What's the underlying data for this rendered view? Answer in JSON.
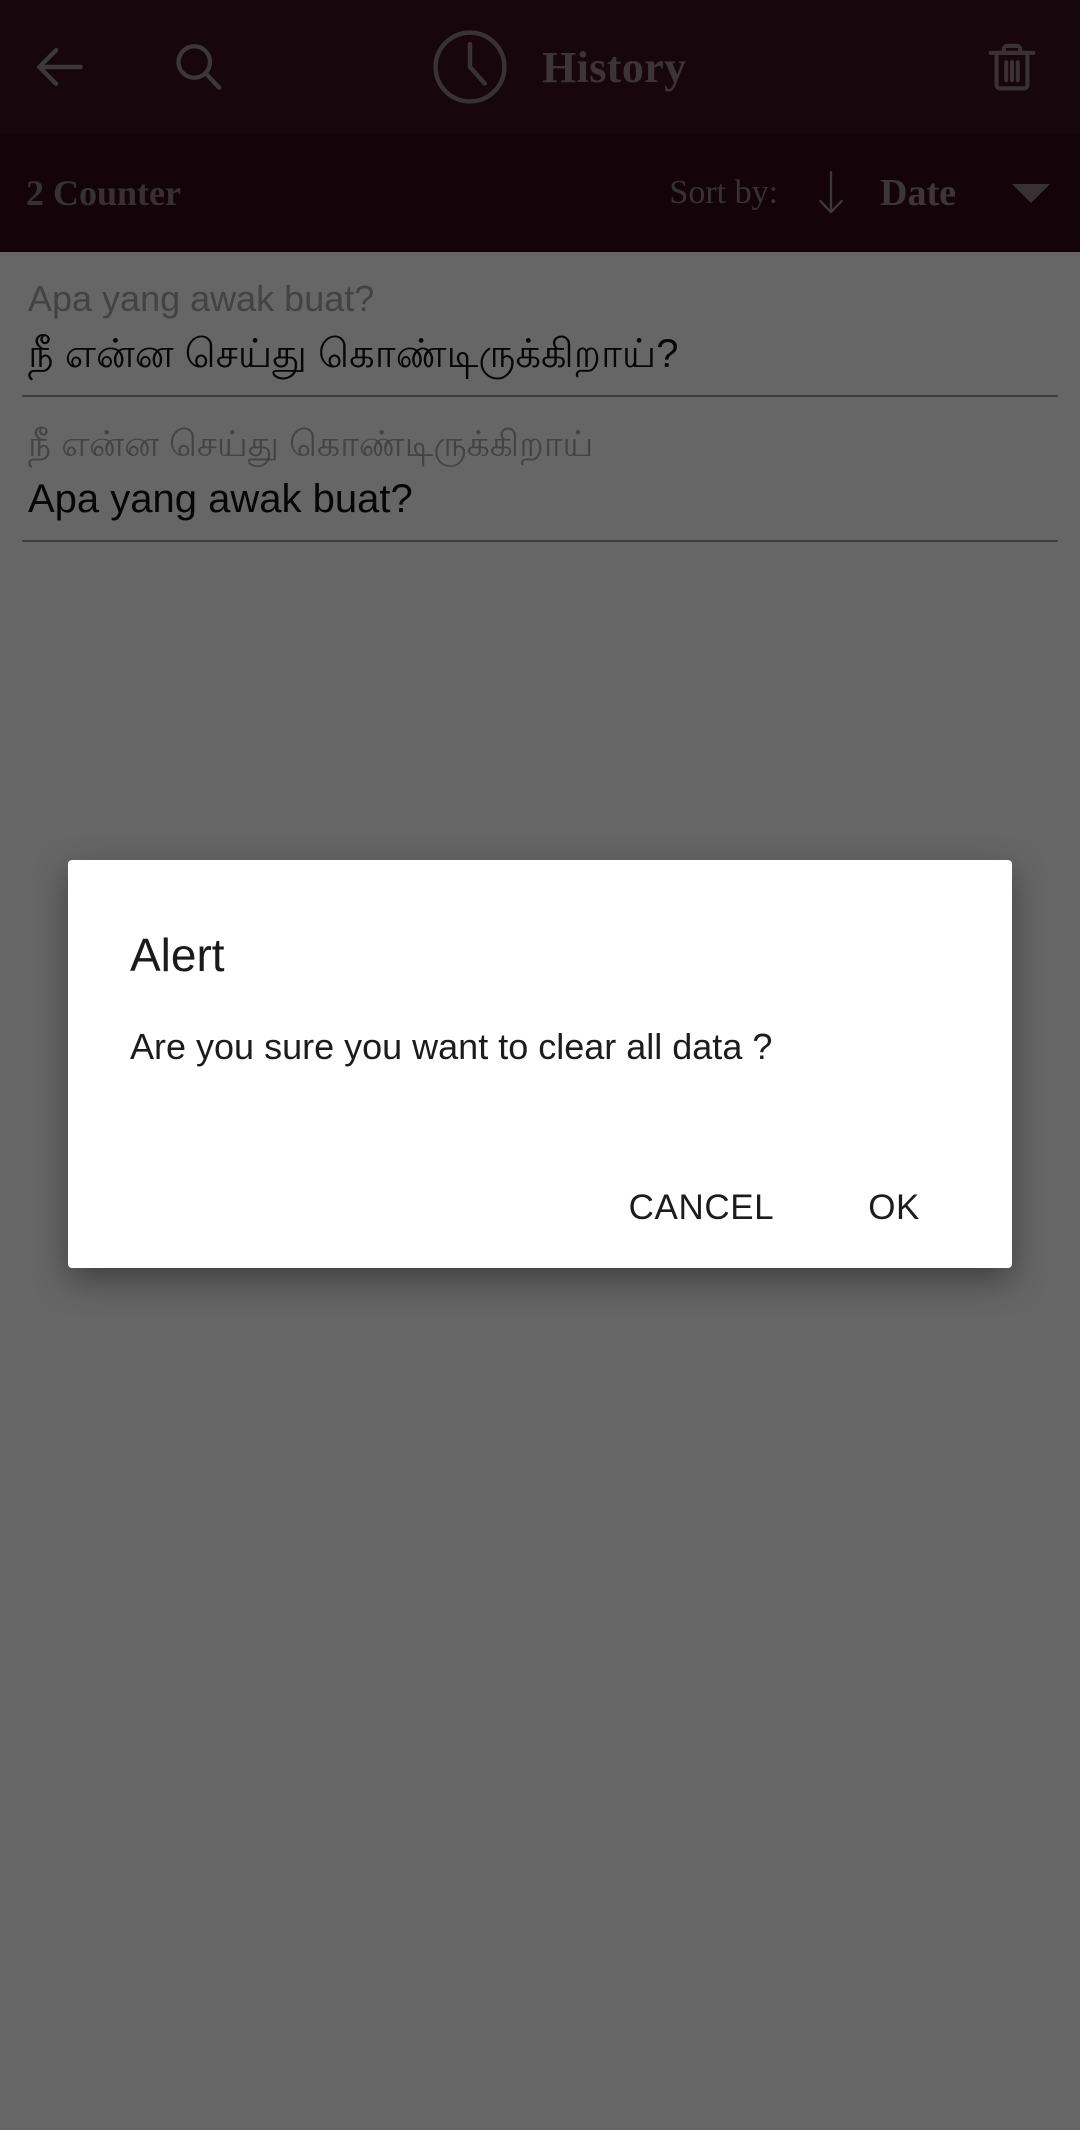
{
  "appbar": {
    "back_icon": "arrow-left-icon",
    "search_icon": "search-icon",
    "clock_icon": "clock-icon",
    "title": "History",
    "delete_icon": "trash-icon",
    "background_color": "#3b0f1f",
    "foreground_color": "#968289"
  },
  "sortbar": {
    "counter_label": "2 Counter",
    "sort_by_label": "Sort by:",
    "sort_direction_icon": "arrow-down-icon",
    "sort_value": "Date",
    "dropdown_icon": "caret-down-icon",
    "background_color": "#330c1b"
  },
  "history": {
    "items": [
      {
        "source_text": "Apa yang awak buat?",
        "target_text": "நீ என்ன செய்து கொண்டிருக்கிறாய்?"
      },
      {
        "source_text": "நீ என்ன செய்து கொண்டிருக்கிறாய்",
        "target_text": "Apa yang awak buat?"
      }
    ]
  },
  "dialog": {
    "title": "Alert",
    "message": "Are you sure you want to clear all data ?",
    "cancel_label": "CANCEL",
    "ok_label": "OK"
  }
}
